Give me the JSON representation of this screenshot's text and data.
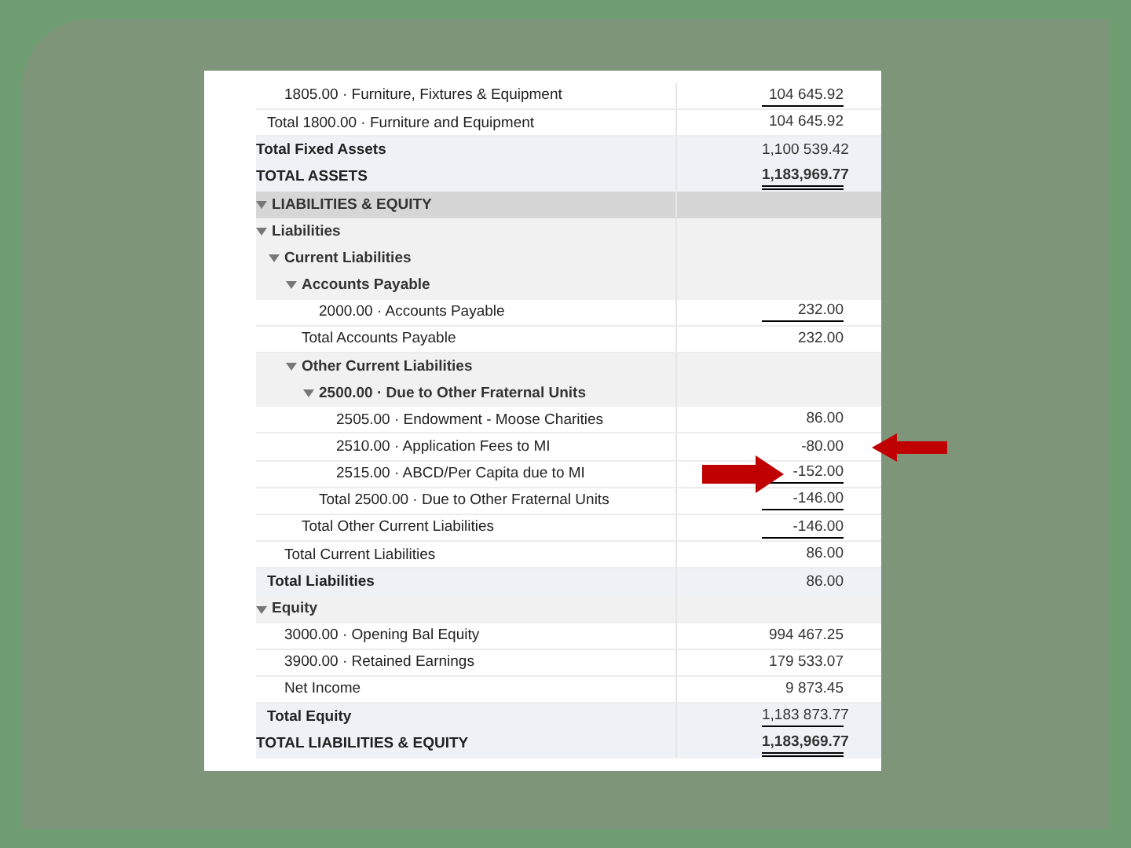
{
  "report": {
    "rows": [
      {
        "children": [
          {
            "children": [
              {
                "kind": "item",
                "label": "1805.00 · Furniture, Fixtures & Equipment",
                "value": "104 645.92",
                "underlined": true
              }
            ]
          },
          {
            "kind": "total",
            "label": "Total 1800.00 · Furniture and Equipment",
            "value": "104 645.92"
          }
        ]
      },
      {
        "kind": "summary",
        "label": "Total Fixed Assets",
        "value": "1,100 539.42"
      },
      {
        "kind": "summary",
        "label": "TOTAL ASSETS",
        "value": "1,183,969.77",
        "underlined": true,
        "double": true,
        "bold_value": true
      },
      {
        "kind": "section",
        "label": "LIABILITIES & EQUITY",
        "expanded": true,
        "children": [
          {
            "kind": "header",
            "label": "Liabilities",
            "expanded": true,
            "children": [
              {
                "kind": "header",
                "label": "Current Liabilities",
                "expanded": true,
                "children": [
                  {
                    "kind": "header",
                    "label": "Accounts Payable",
                    "expanded": true,
                    "children": [
                      {
                        "kind": "item",
                        "label": "2000.00 · Accounts Payable",
                        "value": "232.00",
                        "underlined": true
                      }
                    ]
                  },
                  {
                    "kind": "total",
                    "label": "Total Accounts Payable",
                    "value": "232.00"
                  },
                  {
                    "kind": "header",
                    "label": "Other Current Liabilities",
                    "expanded": true,
                    "children": [
                      {
                        "kind": "header",
                        "label": "2500.00 · Due to Other Fraternal Units",
                        "expanded": true,
                        "children": [
                          {
                            "kind": "item",
                            "label": "2505.00 · Endowment - Moose Charities",
                            "value": "86.00"
                          },
                          {
                            "kind": "item",
                            "label": "2510.00 · Application Fees to MI",
                            "value": "-80.00"
                          },
                          {
                            "kind": "item",
                            "label": "2515.00 · ABCD/Per Capita due to MI",
                            "value": "-152.00",
                            "underlined": true
                          }
                        ]
                      },
                      {
                        "kind": "total",
                        "label": "Total 2500.00 · Due to Other Fraternal Units",
                        "value": "-146.00",
                        "underlined": true
                      }
                    ]
                  },
                  {
                    "kind": "total",
                    "label": "Total Other Current Liabilities",
                    "value": "-146.00",
                    "underlined": true
                  }
                ]
              },
              {
                "kind": "total",
                "label": "Total Current Liabilities",
                "value": "86.00"
              }
            ]
          },
          {
            "kind": "summary",
            "label": "Total Liabilities",
            "value": "86.00"
          },
          {
            "kind": "header",
            "label": "Equity",
            "expanded": true,
            "children": [
              {
                "kind": "item",
                "label": "3000.00 · Opening Bal Equity",
                "value": "994 467.25"
              },
              {
                "kind": "item",
                "label": "3900.00 · Retained Earnings",
                "value": "179 533.07"
              },
              {
                "kind": "item",
                "label": "Net Income",
                "value": "9 873.45"
              }
            ]
          },
          {
            "kind": "summary",
            "label": "Total Equity",
            "value": "1,183 873.77",
            "underlined": true
          }
        ]
      },
      {
        "kind": "summary",
        "label": "TOTAL LIABILITIES & EQUITY",
        "value": "1,183,969.77",
        "underlined": true,
        "double": true,
        "bold_value": true
      }
    ]
  }
}
